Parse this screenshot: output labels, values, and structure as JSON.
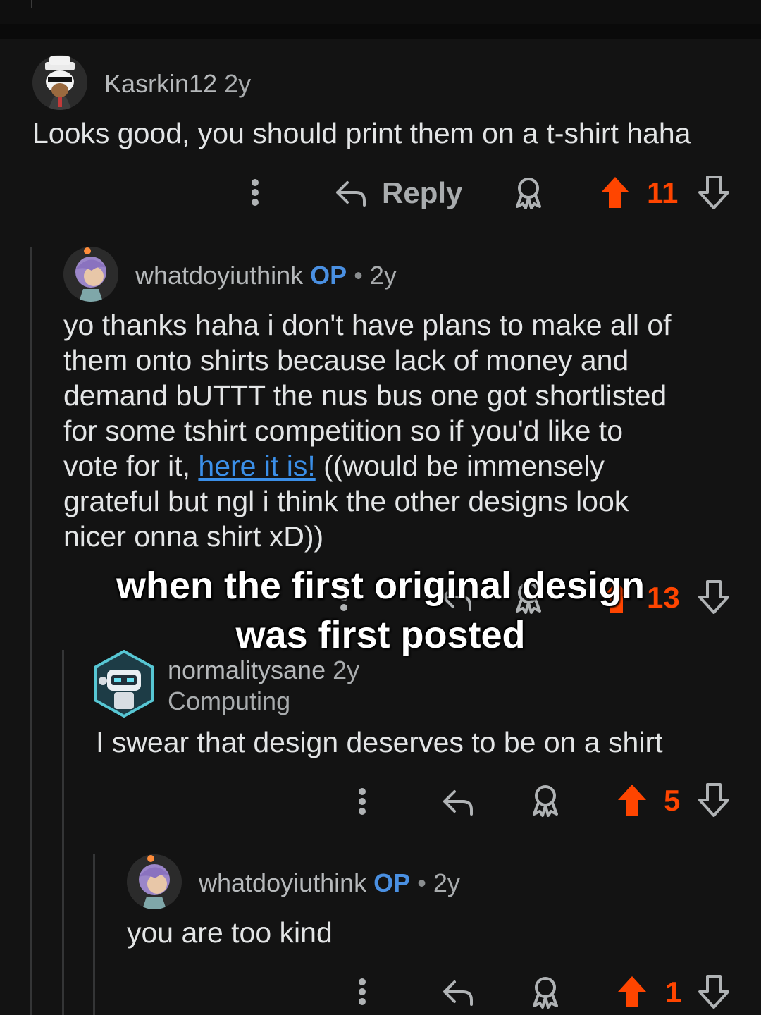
{
  "comments": [
    {
      "username": "Kasrkin12",
      "age": "2y",
      "body": "Looks good, you should print them on a t-shirt haha",
      "reply_label": "Reply",
      "score": "11"
    },
    {
      "username": "whatdoyiuthink",
      "op_badge": "OP",
      "separator": "•",
      "age": "2y",
      "body_lines": [
        "yo thanks haha i don't have plans to make all of",
        "them onto shirts because lack of money and",
        "demand bUTTT the nus bus one got shortlisted",
        "for some tshirt competition so if you'd like to"
      ],
      "body_line5_prefix": "vote for it, ",
      "link_text": "here it is!",
      "body_line5_suffix": " ((would be immensely",
      "body_lines_end": [
        "grateful but ngl i think the other designs look",
        "nicer onna shirt xD))"
      ],
      "score": "13"
    },
    {
      "username": "normalitysane",
      "age": "2y",
      "flair": "Computing",
      "body": "I swear that design deserves to be on a shirt",
      "score": "5"
    },
    {
      "username": "whatdoyiuthink",
      "op_badge": "OP",
      "separator": "•",
      "age": "2y",
      "body": "you are too kind",
      "score": "1"
    }
  ],
  "caption": {
    "line1": "when the first original design",
    "line2": "was first posted"
  },
  "colors": {
    "background": "#131313",
    "upvote_active": "#ff4500",
    "op_badge": "#4a90e2",
    "link": "#3b8fe8"
  },
  "icons": {
    "more": "more-vertical-icon",
    "reply": "reply-arrow-icon",
    "award": "award-icon",
    "upvote": "upvote-arrow-icon",
    "downvote": "downvote-arrow-icon"
  }
}
